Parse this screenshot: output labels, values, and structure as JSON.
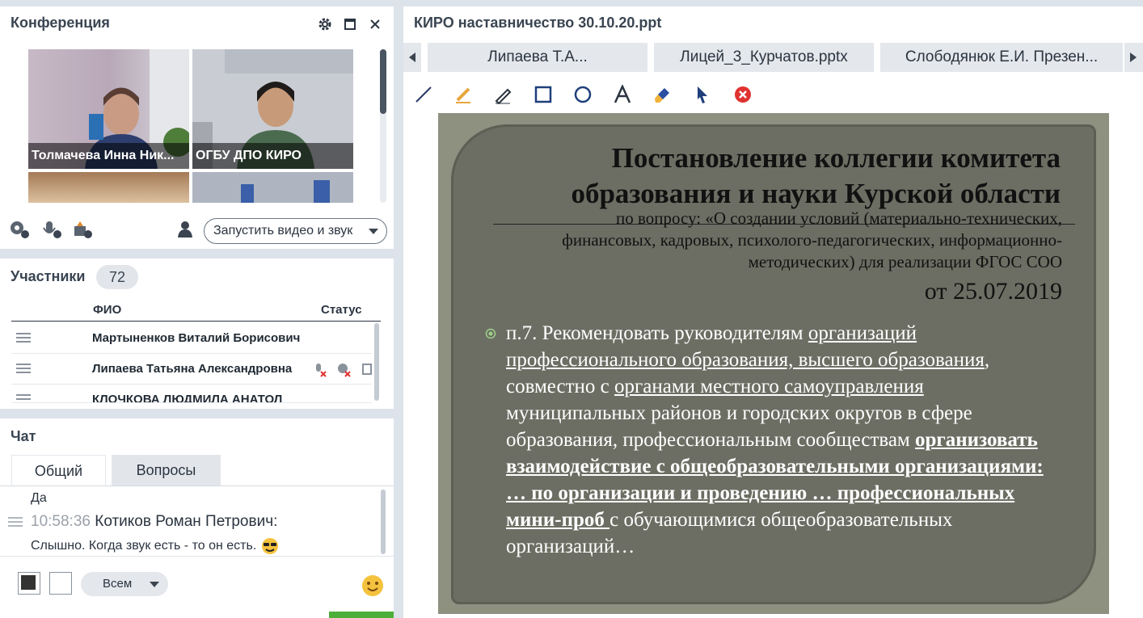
{
  "conference": {
    "title": "Конференция",
    "tiles": [
      {
        "name": "Толмачева Инна  Ник..."
      },
      {
        "name": "ОГБУ ДПО КИРО"
      }
    ],
    "start_button": "Запустить видео и звук"
  },
  "participants": {
    "title": "Участники",
    "count": "72",
    "col_name": "ФИО",
    "col_status": "Статус",
    "rows": [
      {
        "name": "Мартыненков Виталий  Борисович"
      },
      {
        "name": "Липаева Татьяна  Александровна"
      },
      {
        "name": "КЛОЧКОВА ЛЮДМИЛА  АНАТОЛ"
      }
    ]
  },
  "chat": {
    "title": "Чат",
    "tabs": [
      "Общий",
      "Вопросы"
    ],
    "messages": [
      {
        "text": "Да"
      },
      {
        "time": "10:58:36",
        "author": "Котиков Роман Петрович:",
        "text": "Слышно. Когда звук есть - то он есть."
      }
    ],
    "recipient": "Всем"
  },
  "presentation": {
    "title": "КИРО наставничество  30.10.20.ppt",
    "tabs": [
      "Липаева Т.А...",
      "Лицей_3_Курчатов.pptx",
      "Слободянюк Е.И. Презен..."
    ],
    "slide": {
      "title_line1": "Постановление коллегии комитета",
      "title_line2": "образования и науки Курской области",
      "sub_line1": "по вопросу: «О создании условий (материально-технических,",
      "sub_line2": "финансовых, кадровых, психолого-педагогических, информационно-",
      "sub_line3": "методических) для реализации ФГОС СОО",
      "date": "от 25.07.2019",
      "p_start": "п.7. Рекомендовать руководителям ",
      "p_u1": "организаций профессионального образования, высшего образования",
      "p_mid1": ", совместно с ",
      "p_u2": "органами местного самоуправления ",
      "p_mid2": "муниципальных районов и городских округов в сфере образования, профессиональным сообществам ",
      "p_bold": "организовать взаимодействие с общеобразовательными организациями: … по организации и проведению … профессиональных мини-проб ",
      "p_end": "с обучающимися общеобразовательных организаций…"
    }
  },
  "colors": {
    "accent_green": "#4caf3a",
    "slide_bg": "#6c6e63"
  }
}
